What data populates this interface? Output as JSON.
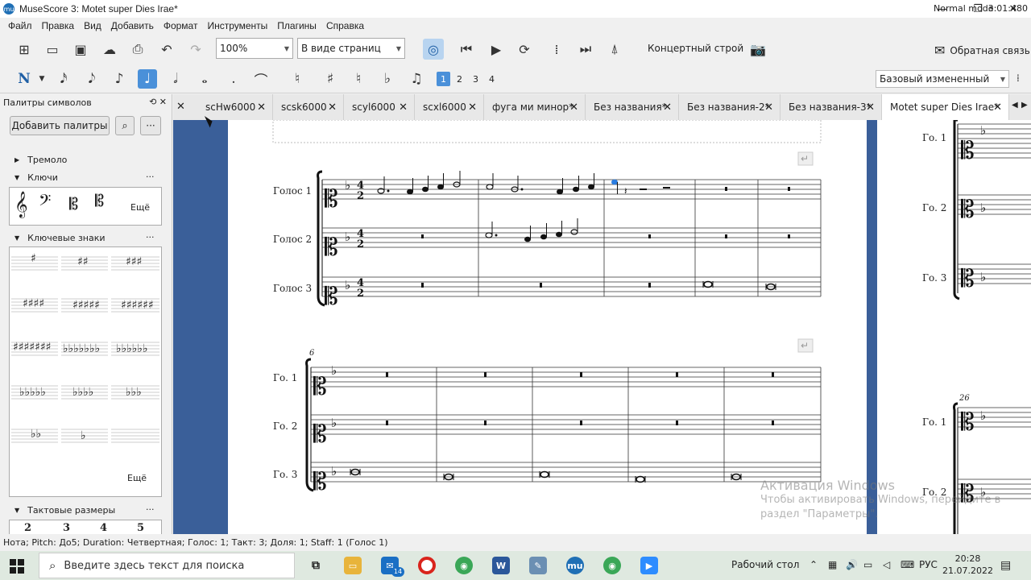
{
  "window": {
    "title": "MuseScore 3: Motet super Dies Irae*",
    "app_icon": "mu",
    "minimize": "—",
    "maximize": "❐",
    "close": "✕"
  },
  "menu": [
    "Файл",
    "Правка",
    "Вид",
    "Добавить",
    "Формат",
    "Инструменты",
    "Плагины",
    "Справка"
  ],
  "toolbar": {
    "zoom_value": "100%",
    "view_mode": "В виде страниц",
    "concert_pitch_label": "Концертный строй",
    "feedback_label": "Обратная связь"
  },
  "note_input": {
    "voices": [
      "1",
      "2",
      "3",
      "4"
    ],
    "active_voice": "1",
    "workspace": "Базовый измененный"
  },
  "palette": {
    "title": "Палитры символов",
    "add_palettes_button": "Добавить палитры",
    "sections": {
      "tremolo": "Тремоло",
      "clefs": "Ключи",
      "key_signatures": "Ключевые знаки",
      "time_signatures": "Тактовые размеры"
    },
    "more_label": "Ещё",
    "time_sig_values": [
      "2",
      "3",
      "4",
      "5"
    ]
  },
  "tabs": [
    {
      "label": "scHw6000",
      "active": false
    },
    {
      "label": "scsk6000",
      "active": false
    },
    {
      "label": "scyl6000",
      "active": false
    },
    {
      "label": "scxl6000",
      "active": false
    },
    {
      "label": "фуга ми минор*",
      "active": false
    },
    {
      "label": "Без названия*",
      "active": false
    },
    {
      "label": "Без названия-2*",
      "active": false
    },
    {
      "label": "Без названия-3*",
      "active": false
    },
    {
      "label": "Motet super Dies Irae*",
      "active": true
    }
  ],
  "score": {
    "system1_staff_labels": [
      "Голос 1",
      "Голос 2",
      "Голос 3"
    ],
    "system2_staff_labels": [
      "Го. 1",
      "Го. 2",
      "Го. 3"
    ],
    "system2_measure_number": "6",
    "time_signature_top": "4",
    "time_signature_bottom": "2",
    "page2_staff_labels_top": [
      "Го. 1",
      "Го. 2",
      "Го. 3"
    ],
    "page2_staff_labels_bottom": [
      "Го. 1",
      "Го. 2"
    ],
    "page2_measure_number": "26"
  },
  "status": {
    "text": "Нота; Pitch: До5; Duration: Четвертная; Голос: 1;  Такт: 3; Доля: 1; Staff: 1 (Голос 1)",
    "mode": "Normal mode",
    "position": "3:01:480"
  },
  "watermark": {
    "title": "Активация Windows",
    "line1": "Чтобы активировать Windows, перейдите в",
    "line2": "раздел \"Параметры\"."
  },
  "taskbar": {
    "search_placeholder": "Введите здесь текст для поиска",
    "desktop_label": "Рабочий стол",
    "language": "РУС",
    "time": "20:28",
    "date": "21.07.2022",
    "mail_badge": "14"
  }
}
